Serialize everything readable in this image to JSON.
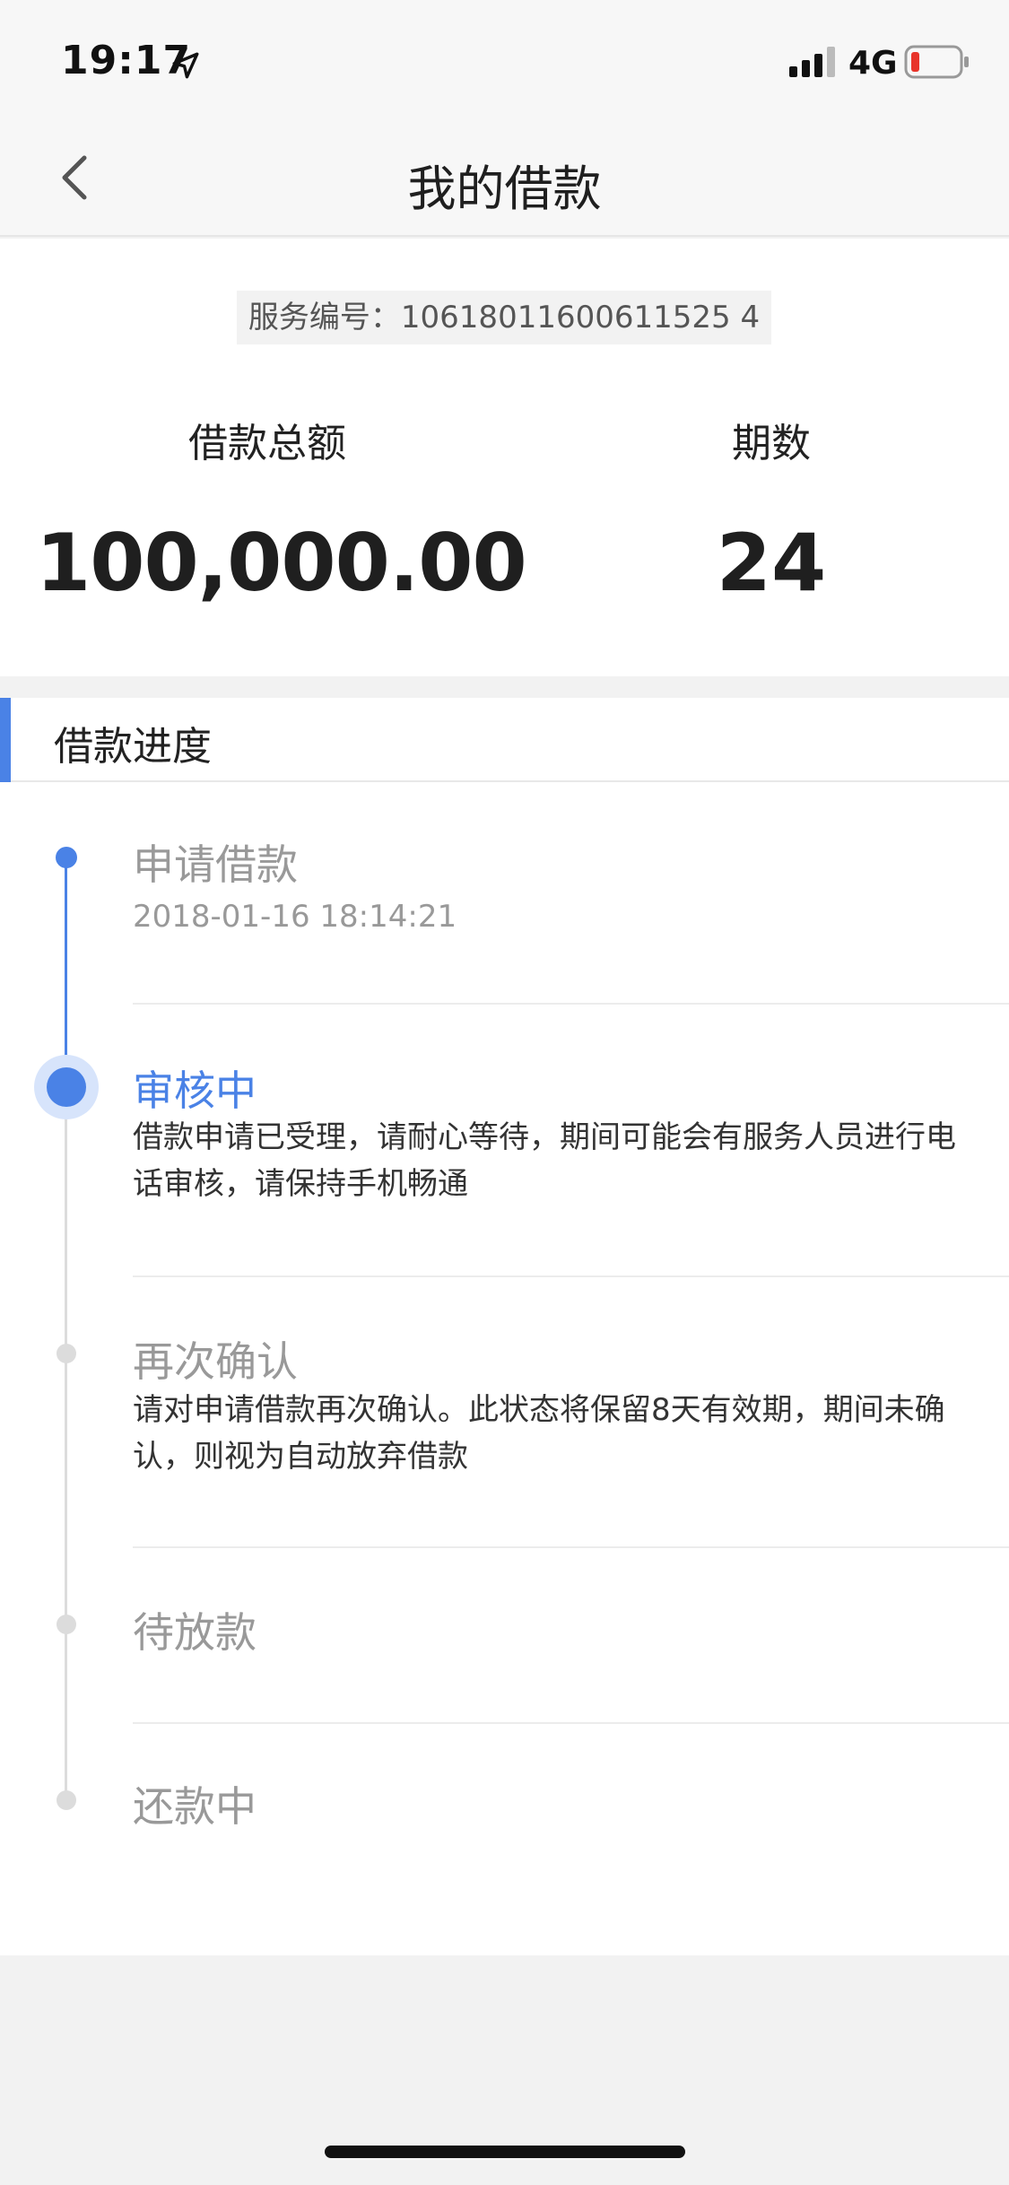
{
  "status_bar": {
    "time": "19:17",
    "network": "4G",
    "icons": [
      "location-arrow-icon",
      "signal-icon",
      "battery-icon"
    ]
  },
  "nav": {
    "title": "我的借款",
    "back_icon": "chevron-left-icon"
  },
  "summary": {
    "service_no": "服务编号：10618011600611525 4",
    "amount_label": "借款总额",
    "amount_value": "100,000.00",
    "periods_label": "期数",
    "periods_value": "24"
  },
  "progress": {
    "title": "借款进度",
    "steps": [
      {
        "title": "申请借款",
        "time": "2018-01-16 18:14:21",
        "state": "done"
      },
      {
        "title": "审核中",
        "desc": "借款申请已受理，请耐心等待，期间可能会有服务人员进行电话审核，请保持手机畅通",
        "state": "current"
      },
      {
        "title": "再次确认",
        "desc": "请对申请借款再次确认。此状态将保留8天有效期，期间未确认，则视为自动放弃借款",
        "state": "pending"
      },
      {
        "title": "待放款",
        "state": "pending"
      },
      {
        "title": "还款中",
        "state": "pending"
      }
    ]
  },
  "colors": {
    "accent": "#4a82e6",
    "inactive": "#dcdcdc"
  }
}
